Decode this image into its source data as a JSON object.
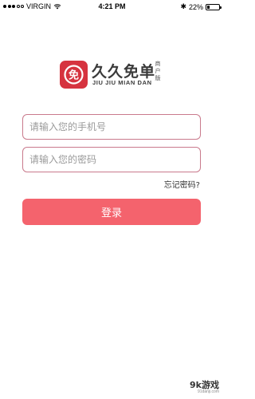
{
  "status_bar": {
    "carrier": "VIRGIN",
    "time": "4:21 PM",
    "battery_percent": "22%",
    "battery_level": 0.22,
    "signal_dots_filled": 3,
    "signal_dots_total": 5
  },
  "logo": {
    "name_cn": "久久免单",
    "badge": "商户版",
    "badge_chars": [
      "商",
      "户",
      "版"
    ],
    "name_en": "JIU JIU MIAN DAN",
    "icon_glyph": "免"
  },
  "form": {
    "phone_placeholder": "请输入您的手机号",
    "password_placeholder": "请输入您的密码",
    "forgot_label": "忘记密码?",
    "login_label": "登录"
  },
  "watermark": {
    "text": "9k游戏",
    "sub": "91danji.com"
  },
  "colors": {
    "accent": "#f4636d",
    "logo_red": "#d6333f",
    "field_border": "#c97a8c"
  }
}
